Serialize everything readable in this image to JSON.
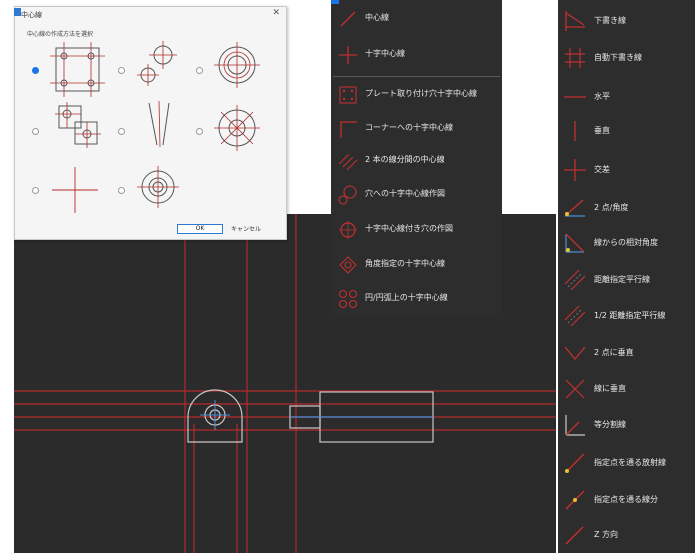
{
  "dialog": {
    "title": "中心線",
    "close": "✕",
    "prompt": "中心線の作成方法を選択",
    "ok_label": "OK",
    "cancel_label": "キャンセル"
  },
  "menu": {
    "items": [
      {
        "label": "中心線",
        "icon": "center-line-icon"
      },
      {
        "label": "十字中心線",
        "icon": "cross-center-line-icon"
      },
      {
        "label": "プレート取り付け穴十字中心線",
        "icon": "plate-hole-icon"
      },
      {
        "label": "コーナーへの十字中心線",
        "icon": "corner-icon"
      },
      {
        "label": "2 本の線分間の中心線",
        "icon": "two-lines-icon"
      },
      {
        "label": "穴への十字中心線作図",
        "icon": "hole-icon"
      },
      {
        "label": "十字中心線付き穴の作図",
        "icon": "hole-with-cross-icon"
      },
      {
        "label": "角度指定の十字中心線",
        "icon": "angle-cross-icon"
      },
      {
        "label": "円/円弧上の十字中心線",
        "icon": "circle-arc-icon"
      }
    ]
  },
  "toolbar": {
    "items": [
      {
        "label": "下書き線",
        "icon": "draft-line-icon"
      },
      {
        "label": "自動下書き線",
        "icon": "auto-draft-icon"
      },
      {
        "label": "水平",
        "icon": "horizontal-icon"
      },
      {
        "label": "垂直",
        "icon": "vertical-icon"
      },
      {
        "label": "交差",
        "icon": "cross-icon"
      },
      {
        "label": "2 点/角度",
        "icon": "two-point-angle-icon"
      },
      {
        "label": "線からの相対角度",
        "icon": "relative-angle-icon"
      },
      {
        "label": "距離指定平行線",
        "icon": "parallel-icon"
      },
      {
        "label": "1/2 距離指定平行線",
        "icon": "half-parallel-icon"
      },
      {
        "label": "2 点に垂直",
        "icon": "perp-two-point-icon"
      },
      {
        "label": "線に垂直",
        "icon": "perp-line-icon"
      },
      {
        "label": "等分割線",
        "icon": "divide-icon"
      },
      {
        "label": "指定点を通る放射線",
        "icon": "ray-icon"
      },
      {
        "label": "指定点を通る線分",
        "icon": "segment-icon"
      },
      {
        "label": "Z 方向",
        "icon": "z-direction-icon"
      }
    ]
  },
  "colors": {
    "canvas_bg": "#2b2b2b",
    "panel_bg": "#2d2d2d",
    "center_line": "#b32a2a",
    "geometry": "#c8c8c8",
    "accent_blue": "#4a90d9"
  }
}
